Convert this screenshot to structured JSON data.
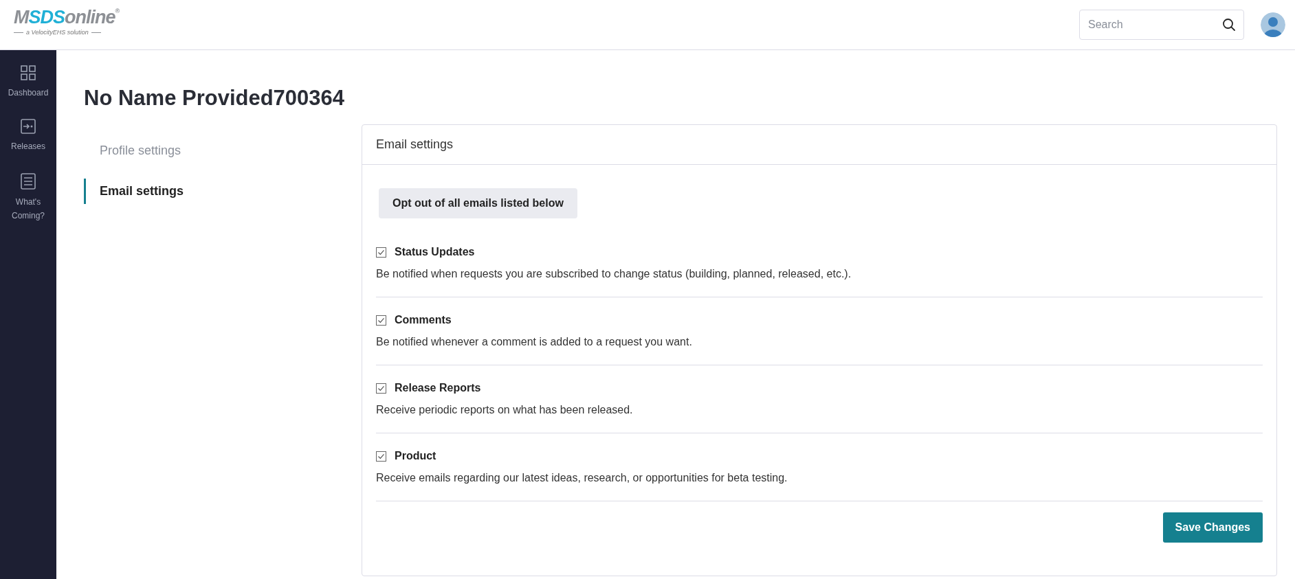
{
  "logo": {
    "prefix": "M",
    "highlight": "SDS",
    "suffix": "online",
    "mark": "®",
    "tagline": "a VelocityEHS solution"
  },
  "search": {
    "placeholder": "Search"
  },
  "sidebar": {
    "items": [
      {
        "label": "Dashboard",
        "kind": "grid"
      },
      {
        "label": "Releases",
        "kind": "enter"
      },
      {
        "label": "What's Coming?",
        "kind": "list"
      }
    ]
  },
  "page_title": "No Name Provided700364",
  "settings_nav": [
    {
      "label": "Profile settings",
      "selected": false
    },
    {
      "label": "Email settings",
      "selected": true
    }
  ],
  "panel": {
    "title": "Email settings",
    "opt_out_button": "Opt out of all emails listed below",
    "options": [
      {
        "label": "Status Updates",
        "checked": true,
        "description": "Be notified when requests you are subscribed to change status (building, planned, released, etc.)."
      },
      {
        "label": "Comments",
        "checked": true,
        "description": "Be notified whenever a comment is added to a request you want."
      },
      {
        "label": "Release Reports",
        "checked": true,
        "description": "Receive periodic reports on what has been released."
      },
      {
        "label": "Product",
        "checked": true,
        "description": "Receive emails regarding our latest ideas, research, or opportunities for beta testing."
      }
    ],
    "save_button": "Save Changes"
  }
}
